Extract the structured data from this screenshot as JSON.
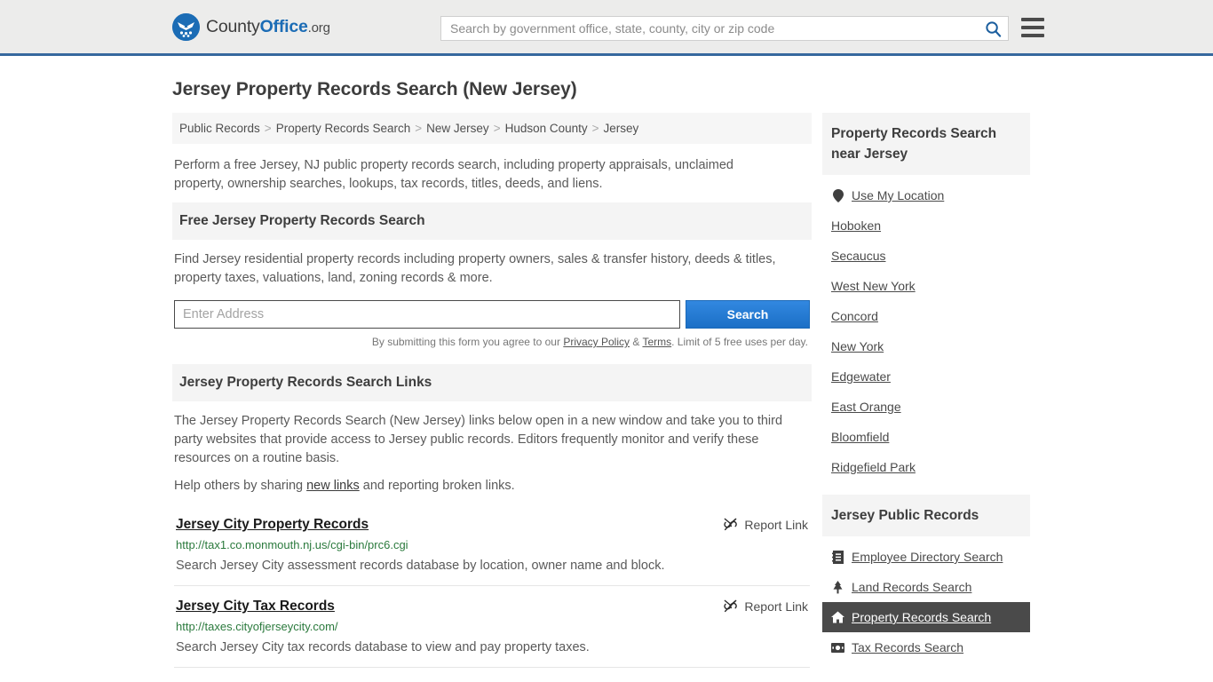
{
  "header": {
    "logo": {
      "part1": "County",
      "part2": "Office",
      "part3": ".org",
      "icon": "eagle-shield-icon"
    },
    "search": {
      "placeholder": "Search by government office, state, county, city or zip code",
      "value": "",
      "icon": "search-icon"
    },
    "menu_icon": "hamburger-menu-icon",
    "accent_color": "#36689e",
    "background_color": "#ececeb"
  },
  "page": {
    "title": "Jersey Property Records Search (New Jersey)"
  },
  "breadcrumb": {
    "separator": ">",
    "items": [
      "Public Records",
      "Property Records Search",
      "New Jersey",
      "Hudson County",
      "Jersey"
    ]
  },
  "intro": "Perform a free Jersey, NJ public property records search, including property appraisals, unclaimed property, ownership searches, lookups, tax records, titles, deeds, and liens.",
  "free_search": {
    "heading": "Free Jersey Property Records Search",
    "description": "Find Jersey residential property records including property owners, sales & transfer history, deeds & titles, property taxes, valuations, land, zoning records & more.",
    "input_placeholder": "Enter Address",
    "input_value": "",
    "submit_label": "Search",
    "submit_color": "#1b6fc6",
    "fineprint_before": "By submitting this form you agree to our ",
    "fineprint_privacy": "Privacy Policy",
    "fineprint_amp": " & ",
    "fineprint_terms": "Terms",
    "fineprint_after": ". Limit of 5 free uses per day."
  },
  "links_section": {
    "heading": "Jersey Property Records Search Links",
    "paragraph": "The Jersey Property Records Search (New Jersey) links below open in a new window and take you to third party websites that provide access to Jersey public records. Editors frequently monitor and verify these resources on a routine basis.",
    "help_before": "Help others by sharing ",
    "help_link": "new links",
    "help_after": " and reporting broken links.",
    "report_label": "Report Link",
    "report_icon": "broken-link-icon",
    "results": [
      {
        "title": "Jersey City Property Records",
        "url": "http://tax1.co.monmouth.nj.us/cgi-bin/prc6.cgi",
        "description": "Search Jersey City assessment records database by location, owner name and block."
      },
      {
        "title": "Jersey City Tax Records",
        "url": "http://taxes.cityofjerseycity.com/",
        "description": "Search Jersey City tax records database to view and pay property taxes."
      }
    ]
  },
  "sidebar": {
    "near_heading": "Property Records Search near Jersey",
    "near_items": [
      {
        "label": "Use My Location",
        "icon": "map-pin-icon"
      },
      {
        "label": "Hoboken",
        "icon": ""
      },
      {
        "label": "Secaucus",
        "icon": ""
      },
      {
        "label": "West New York",
        "icon": ""
      },
      {
        "label": "Concord",
        "icon": ""
      },
      {
        "label": "New York",
        "icon": ""
      },
      {
        "label": "Edgewater",
        "icon": ""
      },
      {
        "label": "East Orange",
        "icon": ""
      },
      {
        "label": "Bloomfield",
        "icon": ""
      },
      {
        "label": "Ridgefield Park",
        "icon": ""
      }
    ],
    "public_heading": "Jersey Public Records",
    "public_items": [
      {
        "label": "Employee Directory Search",
        "icon": "address-book-icon",
        "active": false
      },
      {
        "label": "Land Records Search",
        "icon": "tree-icon",
        "active": false
      },
      {
        "label": "Property Records Search",
        "icon": "home-icon",
        "active": true
      },
      {
        "label": "Tax Records Search",
        "icon": "money-bill-icon",
        "active": false
      }
    ],
    "active_background": "#4a4a4a"
  }
}
